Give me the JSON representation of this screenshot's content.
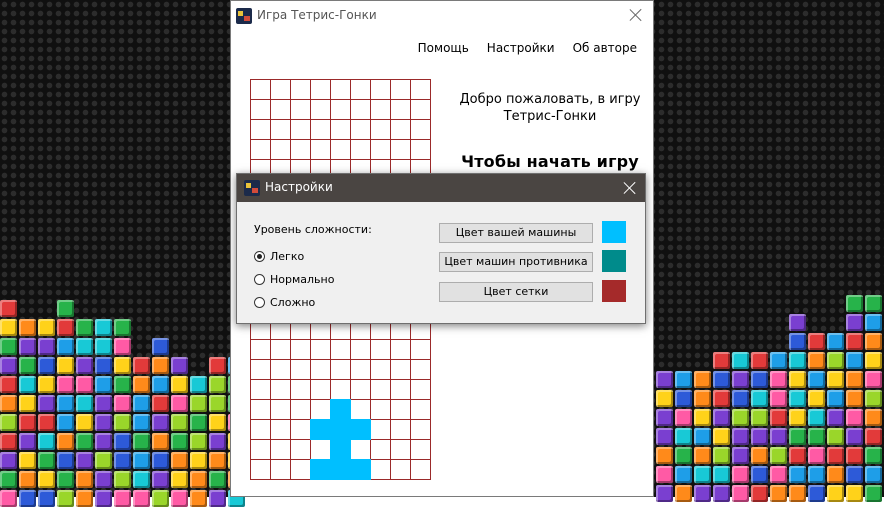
{
  "main_window": {
    "title": "Игра Тетрис-Гонки",
    "menu": [
      "Помощь",
      "Настройки",
      "Об авторе"
    ],
    "welcome_line1": "Добро пожаловать, в игру",
    "welcome_line2": "Тетрис-Гонки",
    "start_prompt": "Чтобы начать игру"
  },
  "settings_dialog": {
    "title": "Настройки",
    "difficulty_label": "Уровень сложности:",
    "difficulty_options": [
      {
        "label": "Легко",
        "selected": true
      },
      {
        "label": "Нормально",
        "selected": false
      },
      {
        "label": "Сложно",
        "selected": false
      }
    ],
    "color_buttons": [
      {
        "label": "Цвет вашей машины",
        "color": "#00bfff"
      },
      {
        "label": "Цвет машин противника",
        "color": "#008b8b"
      },
      {
        "label": "Цвет сетки",
        "color": "#a52a2a"
      }
    ]
  },
  "colors": {
    "player_car": "#00bfff",
    "grid_lines": "#9b2a2a",
    "dialog_titlebar": "#4a4542"
  }
}
